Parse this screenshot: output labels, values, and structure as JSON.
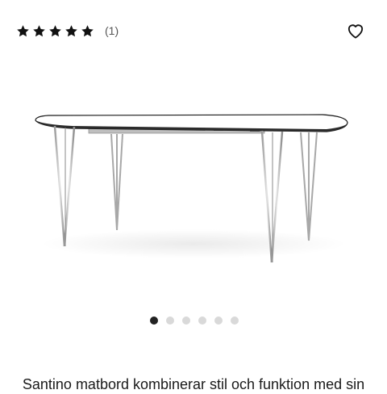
{
  "rating": {
    "stars_filled": 5,
    "stars_total": 5,
    "review_count_label": "(1)"
  },
  "favorite": {
    "icon": "heart-outline-icon"
  },
  "product_image": {
    "subject": "extendable-dining-table"
  },
  "carousel": {
    "count": 6,
    "active_index": 0
  },
  "description": {
    "text": "Santino matbord kombinerar stil och funktion med sin"
  },
  "colors": {
    "star": "#111111",
    "dot_active": "#222222",
    "dot_inactive": "#d9d9d9"
  }
}
